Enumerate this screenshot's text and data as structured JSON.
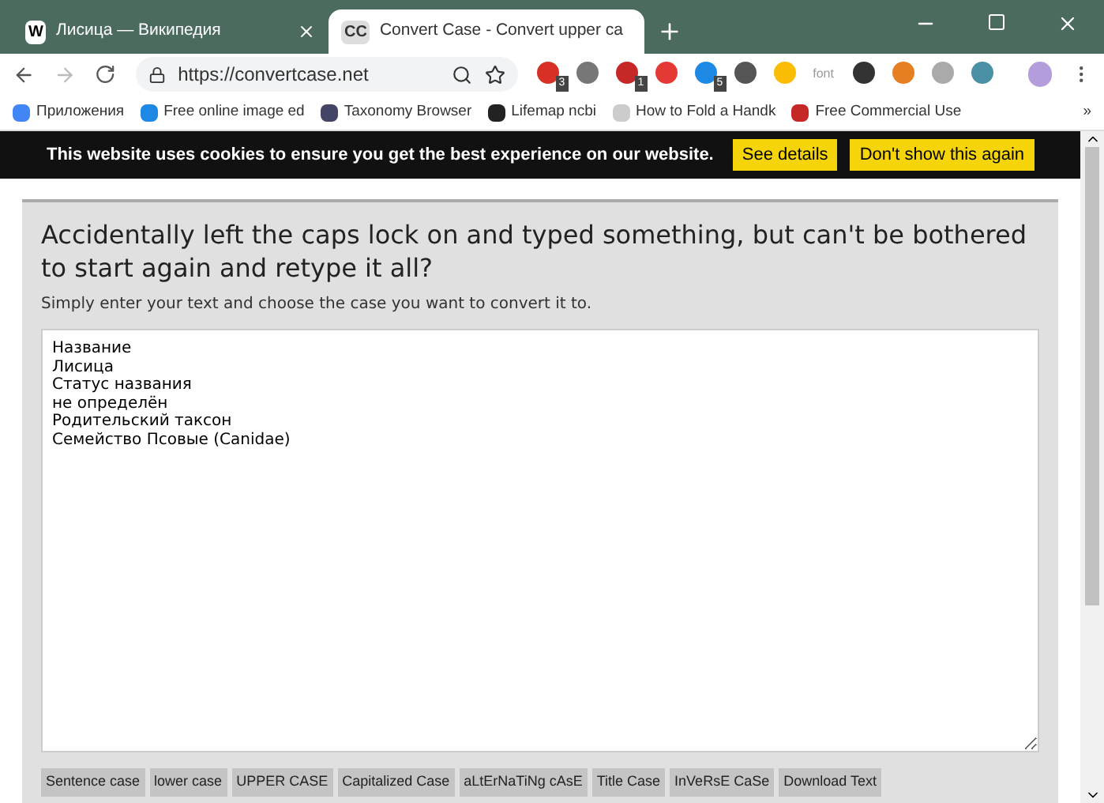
{
  "tabs": [
    {
      "label": "Лисица — Википедия",
      "icon": "W",
      "selected": false
    },
    {
      "label": "Convert Case - Convert upper ca",
      "icon": "CC",
      "selected": true
    }
  ],
  "address": "https://convertcase.net",
  "extensions": [
    {
      "kind": "icon",
      "badge": "3"
    },
    {
      "kind": "icon"
    },
    {
      "kind": "icon",
      "badge": "1"
    },
    {
      "kind": "icon"
    },
    {
      "kind": "icon",
      "badge": "5"
    },
    {
      "kind": "icon"
    },
    {
      "kind": "icon"
    },
    {
      "kind": "label",
      "text": "font"
    },
    {
      "kind": "icon"
    },
    {
      "kind": "icon"
    },
    {
      "kind": "icon"
    },
    {
      "kind": "icon"
    }
  ],
  "bookmarks": [
    "Приложения",
    "Free online image ed",
    "Taxonomy Browser",
    "Lifemap ncbi",
    "How to Fold a Handk",
    "Free Commercial Use"
  ],
  "bookmarks_more": "»",
  "cookie_banner": {
    "text": "This website uses cookies to ensure you get the best experience on our website.",
    "buttons": [
      "See details",
      "Don't show this again"
    ]
  },
  "heading": "Accidentally left the caps lock on and typed something, but can't be bothered to start again and retype it all?",
  "subheading": "Simply enter your text and choose the case you want to convert it to.",
  "text_lines": [
    "Название",
    "Лисица",
    "Статус названия",
    "не определён",
    "Родительский таксон",
    "Семейство Псовые (Canidae)"
  ],
  "case_buttons": [
    "Sentence case",
    "lower case",
    "UPPER CASE",
    "Capitalized Case",
    "aLtErNaTiNg cAsE",
    "Title Case",
    "InVeRsE CaSe",
    "Download Text"
  ]
}
